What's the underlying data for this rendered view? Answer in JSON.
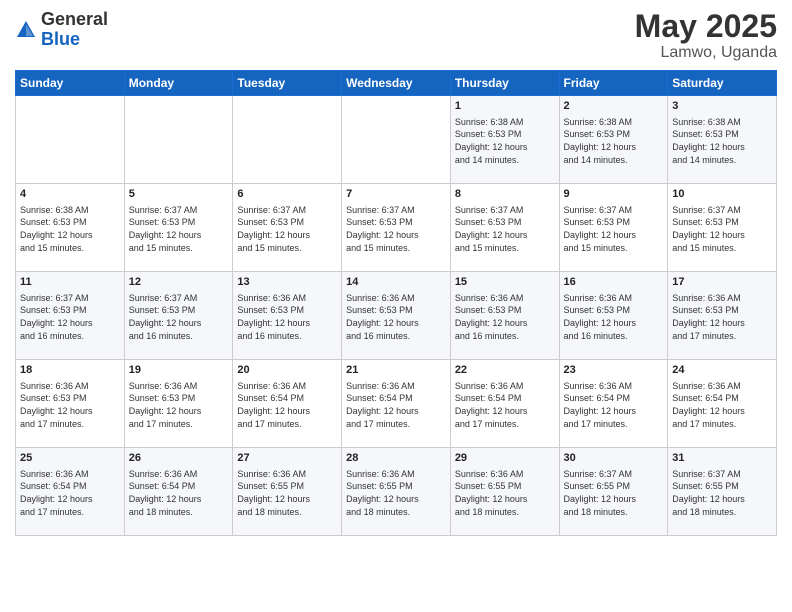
{
  "header": {
    "logo_general": "General",
    "logo_blue": "Blue",
    "title": "May 2025",
    "location": "Lamwo, Uganda"
  },
  "weekdays": [
    "Sunday",
    "Monday",
    "Tuesday",
    "Wednesday",
    "Thursday",
    "Friday",
    "Saturday"
  ],
  "weeks": [
    [
      {
        "day": "",
        "info": ""
      },
      {
        "day": "",
        "info": ""
      },
      {
        "day": "",
        "info": ""
      },
      {
        "day": "",
        "info": ""
      },
      {
        "day": "1",
        "info": "Sunrise: 6:38 AM\nSunset: 6:53 PM\nDaylight: 12 hours\nand 14 minutes."
      },
      {
        "day": "2",
        "info": "Sunrise: 6:38 AM\nSunset: 6:53 PM\nDaylight: 12 hours\nand 14 minutes."
      },
      {
        "day": "3",
        "info": "Sunrise: 6:38 AM\nSunset: 6:53 PM\nDaylight: 12 hours\nand 14 minutes."
      }
    ],
    [
      {
        "day": "4",
        "info": "Sunrise: 6:38 AM\nSunset: 6:53 PM\nDaylight: 12 hours\nand 15 minutes."
      },
      {
        "day": "5",
        "info": "Sunrise: 6:37 AM\nSunset: 6:53 PM\nDaylight: 12 hours\nand 15 minutes."
      },
      {
        "day": "6",
        "info": "Sunrise: 6:37 AM\nSunset: 6:53 PM\nDaylight: 12 hours\nand 15 minutes."
      },
      {
        "day": "7",
        "info": "Sunrise: 6:37 AM\nSunset: 6:53 PM\nDaylight: 12 hours\nand 15 minutes."
      },
      {
        "day": "8",
        "info": "Sunrise: 6:37 AM\nSunset: 6:53 PM\nDaylight: 12 hours\nand 15 minutes."
      },
      {
        "day": "9",
        "info": "Sunrise: 6:37 AM\nSunset: 6:53 PM\nDaylight: 12 hours\nand 15 minutes."
      },
      {
        "day": "10",
        "info": "Sunrise: 6:37 AM\nSunset: 6:53 PM\nDaylight: 12 hours\nand 15 minutes."
      }
    ],
    [
      {
        "day": "11",
        "info": "Sunrise: 6:37 AM\nSunset: 6:53 PM\nDaylight: 12 hours\nand 16 minutes."
      },
      {
        "day": "12",
        "info": "Sunrise: 6:37 AM\nSunset: 6:53 PM\nDaylight: 12 hours\nand 16 minutes."
      },
      {
        "day": "13",
        "info": "Sunrise: 6:36 AM\nSunset: 6:53 PM\nDaylight: 12 hours\nand 16 minutes."
      },
      {
        "day": "14",
        "info": "Sunrise: 6:36 AM\nSunset: 6:53 PM\nDaylight: 12 hours\nand 16 minutes."
      },
      {
        "day": "15",
        "info": "Sunrise: 6:36 AM\nSunset: 6:53 PM\nDaylight: 12 hours\nand 16 minutes."
      },
      {
        "day": "16",
        "info": "Sunrise: 6:36 AM\nSunset: 6:53 PM\nDaylight: 12 hours\nand 16 minutes."
      },
      {
        "day": "17",
        "info": "Sunrise: 6:36 AM\nSunset: 6:53 PM\nDaylight: 12 hours\nand 17 minutes."
      }
    ],
    [
      {
        "day": "18",
        "info": "Sunrise: 6:36 AM\nSunset: 6:53 PM\nDaylight: 12 hours\nand 17 minutes."
      },
      {
        "day": "19",
        "info": "Sunrise: 6:36 AM\nSunset: 6:53 PM\nDaylight: 12 hours\nand 17 minutes."
      },
      {
        "day": "20",
        "info": "Sunrise: 6:36 AM\nSunset: 6:54 PM\nDaylight: 12 hours\nand 17 minutes."
      },
      {
        "day": "21",
        "info": "Sunrise: 6:36 AM\nSunset: 6:54 PM\nDaylight: 12 hours\nand 17 minutes."
      },
      {
        "day": "22",
        "info": "Sunrise: 6:36 AM\nSunset: 6:54 PM\nDaylight: 12 hours\nand 17 minutes."
      },
      {
        "day": "23",
        "info": "Sunrise: 6:36 AM\nSunset: 6:54 PM\nDaylight: 12 hours\nand 17 minutes."
      },
      {
        "day": "24",
        "info": "Sunrise: 6:36 AM\nSunset: 6:54 PM\nDaylight: 12 hours\nand 17 minutes."
      }
    ],
    [
      {
        "day": "25",
        "info": "Sunrise: 6:36 AM\nSunset: 6:54 PM\nDaylight: 12 hours\nand 17 minutes."
      },
      {
        "day": "26",
        "info": "Sunrise: 6:36 AM\nSunset: 6:54 PM\nDaylight: 12 hours\nand 18 minutes."
      },
      {
        "day": "27",
        "info": "Sunrise: 6:36 AM\nSunset: 6:55 PM\nDaylight: 12 hours\nand 18 minutes."
      },
      {
        "day": "28",
        "info": "Sunrise: 6:36 AM\nSunset: 6:55 PM\nDaylight: 12 hours\nand 18 minutes."
      },
      {
        "day": "29",
        "info": "Sunrise: 6:36 AM\nSunset: 6:55 PM\nDaylight: 12 hours\nand 18 minutes."
      },
      {
        "day": "30",
        "info": "Sunrise: 6:37 AM\nSunset: 6:55 PM\nDaylight: 12 hours\nand 18 minutes."
      },
      {
        "day": "31",
        "info": "Sunrise: 6:37 AM\nSunset: 6:55 PM\nDaylight: 12 hours\nand 18 minutes."
      }
    ]
  ]
}
